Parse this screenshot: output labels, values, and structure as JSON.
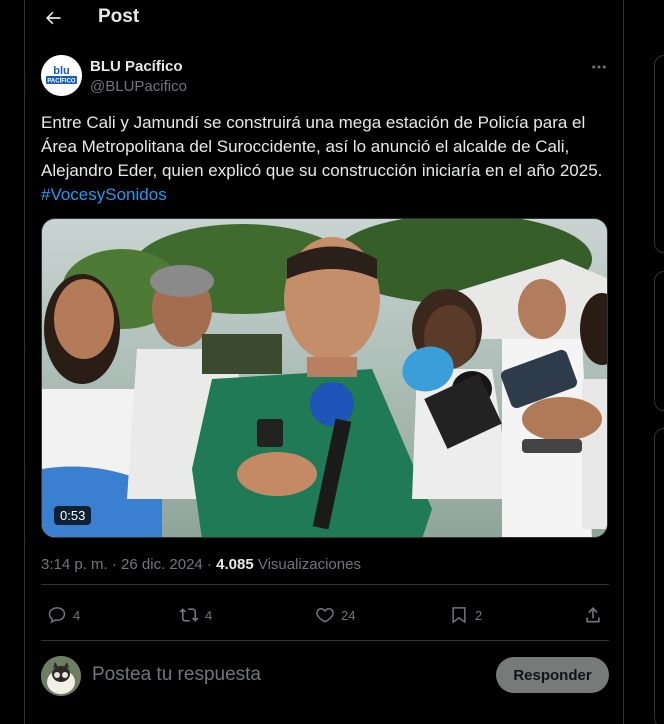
{
  "header": {
    "title": "Post"
  },
  "author": {
    "display_name": "BLU Pacífico",
    "handle": "@BLUPacifico",
    "avatar_text": "PACÍFICO"
  },
  "tweet": {
    "text": "Entre Cali y Jamundí se construirá una mega estación de Policía para el Área Metropolitana del Suroccidente, así lo anunció el alcalde de Cali, Alejandro Eder, quien explicó que su construcción iniciaría en el año 2025. ",
    "hashtag": "#VocesySonidos",
    "video_duration": "0:53"
  },
  "meta": {
    "time": "3:14 p. m.",
    "separator": " · ",
    "date": "26 dic. 2024",
    "separator2": " · ",
    "views_count": "4.085",
    "views_label": " Visualizaciones"
  },
  "actions": {
    "replies": "4",
    "reposts": "4",
    "likes": "24",
    "bookmarks": "2"
  },
  "reply": {
    "placeholder": "Postea tu respuesta",
    "button_label": "Responder"
  },
  "colors": {
    "background": "#000000",
    "accent": "#1d9bf0",
    "muted": "#71767b",
    "border": "#2f3336"
  }
}
